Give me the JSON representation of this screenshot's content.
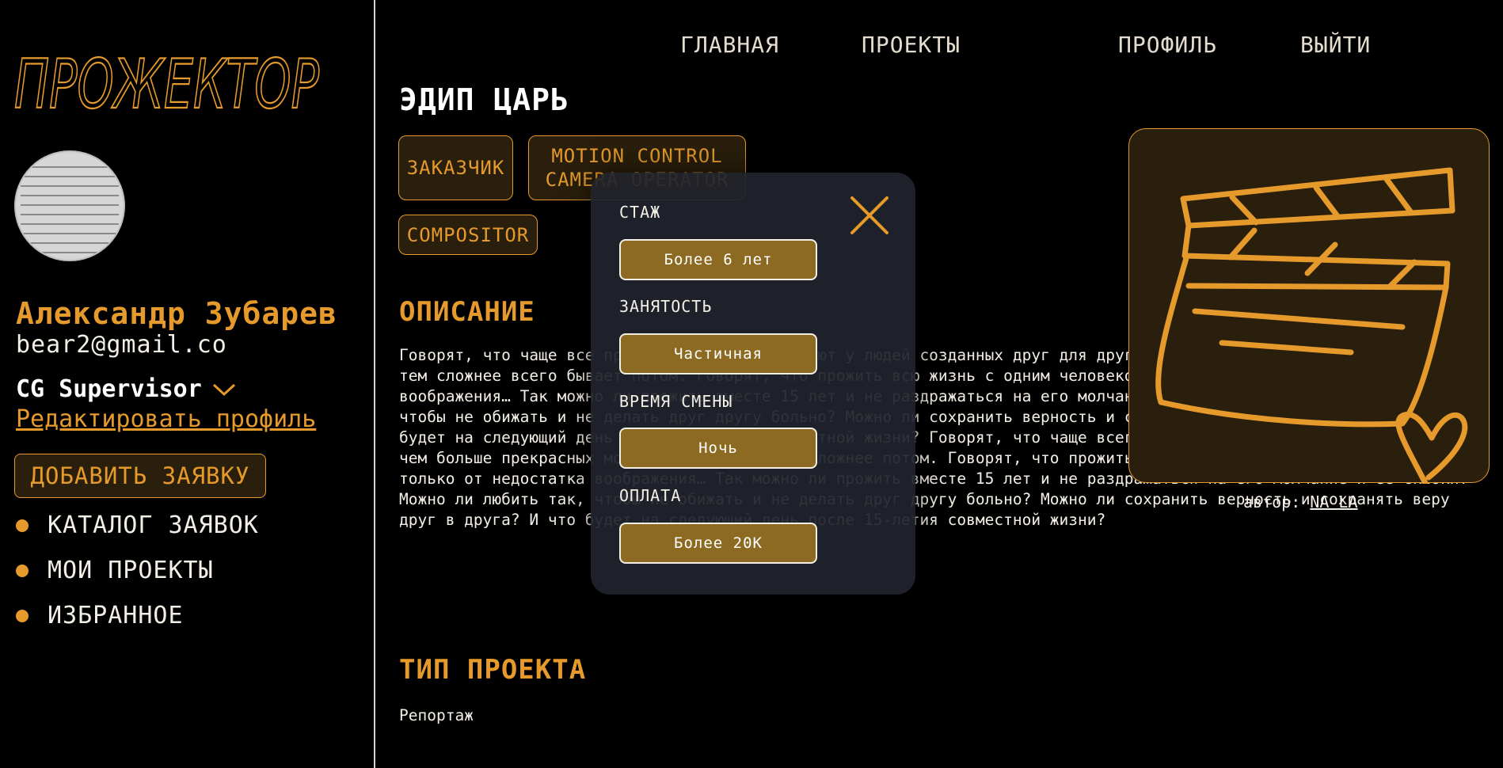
{
  "brand": {
    "logo_text": "ПРОЖЕКТОР"
  },
  "topnav": {
    "home": "ГЛАВНАЯ",
    "projects": "ПРОЕКТЫ",
    "profile": "ПРОФИЛЬ",
    "logout": "ВЫЙТИ"
  },
  "user": {
    "name": "Александр Зубарев",
    "email": "bear2@gmail.co",
    "role": "CG Supervisor",
    "edit_profile": "Редактировать профиль"
  },
  "sidebar": {
    "add_request": "ДОБАВИТЬ ЗАЯВКУ",
    "items": [
      {
        "label": "КАТАЛОГ ЗАЯВОК"
      },
      {
        "label": "МОИ ПРОЕКТЫ"
      },
      {
        "label": "ИЗБРАННОЕ"
      }
    ]
  },
  "project": {
    "title": "ЭДИП ЦАРЬ",
    "tags": [
      "ЗАКАЗЧИК",
      "MOTION CONTROL CAMERA OPERATOR",
      "COMPOSITOR"
    ],
    "description_title": "ОПИСАНИЕ",
    "description": "Говорят, что чаще все прекрасные моменты бывают у людей созданных друг для друга, и чем больше прекрасных моментов, тем сложнее всего бывает потом. Говорят, что прожить всю жизнь с одним человеком можно только от недостатка воображения… Так можно ли прожить вместе 15 лет и не раздражаться на его молчание и ее склоки? Можно ли любить так, чтобы не обижать и не делать друг другу больно? Можно ли сохранить верность и сохранять веру друг в друга? И что будет на следующий день после 15-летия совместной жизни? Говорят, что чаще всего пары, созданные друг для друга, и чем больше прекрасных моментов вначале, тем сложнее потом. Говорят, что прожить всю жизнь с одним человеком можно только от недостатка воображения… Так можно ли прожить вместе 15 лет и не раздражаться на его молчание и ее склоки? Можно ли любить так, чтобы не обижать и не делать друг другу больно? Можно ли сохранить верность и сохранять веру друг в друга? И что будет на следующий день после 15-летия совместной жизни?",
    "type_title": "ТИП ПРОЕКТА",
    "type_value": "Репортаж",
    "author_label": "автор:",
    "author_name": "NA LA"
  },
  "modal": {
    "experience_label": "СТАЖ",
    "experience_value": "Более 6 лет",
    "employment_label": "ЗАНЯТОСТЬ",
    "employment_value": "Частичная",
    "shift_label": "ВРЕМЯ СМЕНЫ",
    "shift_value": "Ночь",
    "payment_label": "ОПЛАТА",
    "payment_value": "Более 20К"
  },
  "colors": {
    "accent": "#e59a2b",
    "accent_dark": "#2a1f0c",
    "modal_button": "#8c6a22",
    "background": "#000000"
  },
  "icons": [
    "chevron-down-icon",
    "bullet-icon",
    "close-icon",
    "clapperboard-icon",
    "heart-icon"
  ]
}
